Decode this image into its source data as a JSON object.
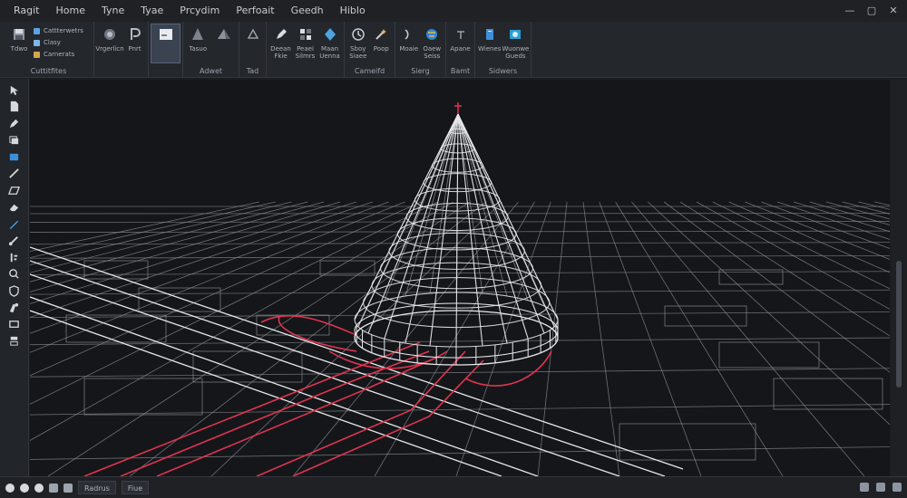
{
  "menubar": {
    "items": [
      "Ragit",
      "Home",
      "Tyne",
      "Tyae",
      "Prcydim",
      "Perfoait",
      "Geedh",
      "Hiblo"
    ],
    "window_controls": [
      "—",
      "▢",
      "✕"
    ]
  },
  "ribbon": {
    "groups": [
      {
        "label": "Cuttitfites",
        "buttons": [
          {
            "label": "Tdwo",
            "icon": "save-icon"
          }
        ],
        "list": [
          {
            "label": "Cattterwetrs",
            "color": "#5aa3e6"
          },
          {
            "label": "Clasy",
            "color": "#7fb4e8"
          },
          {
            "label": "Carnerats",
            "color": "#d6a54b"
          }
        ]
      },
      {
        "label": "",
        "buttons": [
          {
            "label": "Vrgerlicn",
            "icon": "cylinder-icon"
          },
          {
            "label": "Pnrt",
            "icon": "p-icon"
          }
        ]
      },
      {
        "label": "",
        "buttons": [
          {
            "label": "",
            "icon": "sheet-icon",
            "active": true
          }
        ]
      },
      {
        "label": "Adwet",
        "buttons": [
          {
            "label": "Tasuo",
            "icon": "cone-icon"
          },
          {
            "label": "",
            "icon": "pyramid-icon"
          }
        ]
      },
      {
        "label": "Tad",
        "buttons": [
          {
            "label": "",
            "icon": "shape-icon"
          }
        ]
      },
      {
        "label": "",
        "buttons": [
          {
            "label": "Deean Fkie",
            "icon": "pen-icon"
          },
          {
            "label": "Peaei Silmrs",
            "icon": "grid-icon"
          },
          {
            "label": "Maan Uenna",
            "icon": "diamond-icon"
          }
        ]
      },
      {
        "label": "Cameifd",
        "buttons": [
          {
            "label": "Sboy Siaee",
            "icon": "clock-icon"
          },
          {
            "label": "Poop",
            "icon": "wand-icon"
          }
        ]
      },
      {
        "label": "Sierg",
        "buttons": [
          {
            "label": "Moaie",
            "icon": "curve-icon"
          },
          {
            "label": "Oaew Seiss",
            "icon": "globe-icon"
          }
        ]
      },
      {
        "label": "Bamt",
        "buttons": [
          {
            "label": "Apane",
            "icon": "text-icon"
          }
        ]
      },
      {
        "label": "Sidwers",
        "buttons": [
          {
            "label": "Wienes",
            "icon": "book-icon"
          },
          {
            "label": "Wuonwe Gueds",
            "icon": "photo-icon"
          }
        ]
      }
    ]
  },
  "lefttools": [
    "select-icon",
    "file-icon",
    "pen-icon",
    "layers-icon",
    "rect-icon",
    "line-icon",
    "parallelogram-icon",
    "eraser-icon",
    "pencil-icon",
    "brush-icon",
    "align-icon",
    "search-icon",
    "shield-icon",
    "tag-icon",
    "monitor-icon",
    "stack-icon"
  ],
  "viewport": {
    "wire_color": "#e8e9ec",
    "accent_color": "#e0344f",
    "background": "#15161a"
  },
  "statusbar": {
    "fields": [
      "Radrus",
      "Fiue"
    ]
  }
}
